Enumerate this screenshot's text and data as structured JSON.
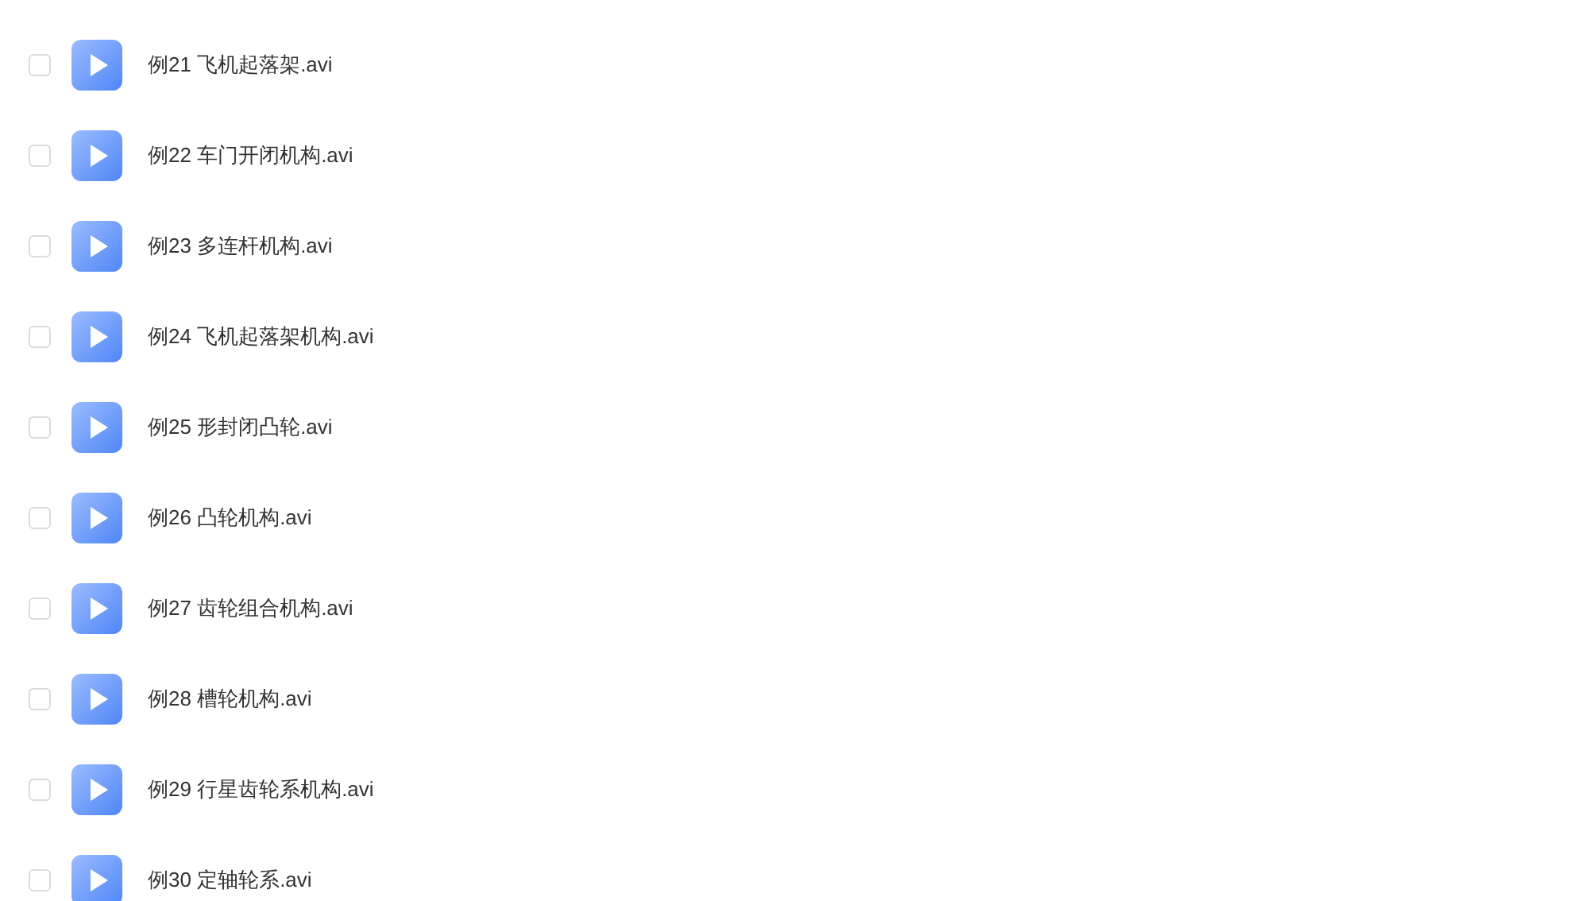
{
  "files": [
    {
      "name": "例21 飞机起落架.avi",
      "checked": false
    },
    {
      "name": "例22 车门开闭机构.avi",
      "checked": false
    },
    {
      "name": "例23 多连杆机构.avi",
      "checked": false
    },
    {
      "name": "例24 飞机起落架机构.avi",
      "checked": false
    },
    {
      "name": "例25 形封闭凸轮.avi",
      "checked": false
    },
    {
      "name": "例26 凸轮机构.avi",
      "checked": false
    },
    {
      "name": "例27 齿轮组合机构.avi",
      "checked": false
    },
    {
      "name": "例28 槽轮机构.avi",
      "checked": false
    },
    {
      "name": "例29 行星齿轮系机构.avi",
      "checked": false
    },
    {
      "name": "例30 定轴轮系.avi",
      "checked": false
    }
  ]
}
